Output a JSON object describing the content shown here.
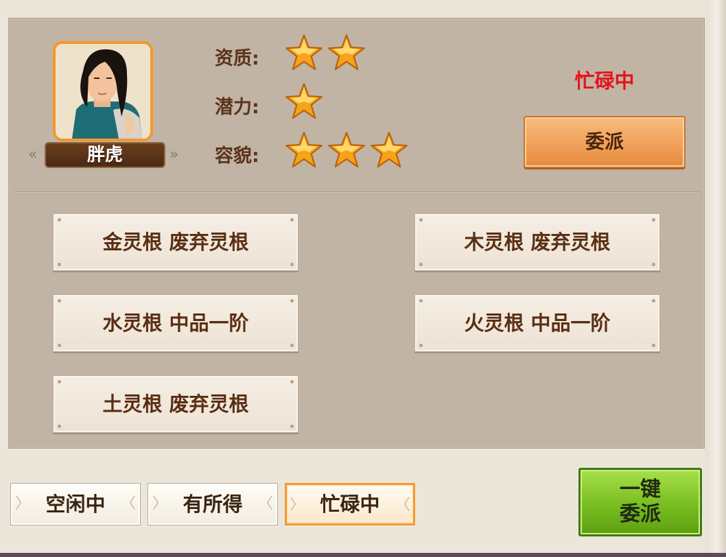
{
  "character": {
    "name": "胖虎",
    "status": "忙碌中",
    "assign_label": "委派",
    "stats": [
      {
        "label": "资质:",
        "stars": 2
      },
      {
        "label": "潜力:",
        "stars": 1
      },
      {
        "label": "容貌:",
        "stars": 3
      }
    ],
    "spirit_roots": [
      {
        "text": "金灵根 废弃灵根"
      },
      {
        "text": "木灵根 废弃灵根"
      },
      {
        "text": "水灵根 中品一阶"
      },
      {
        "text": "火灵根 中品一阶"
      },
      {
        "text": "土灵根 废弃灵根"
      }
    ]
  },
  "tabs": [
    {
      "label": "空闲中",
      "active": false
    },
    {
      "label": "有所得",
      "active": false
    },
    {
      "label": "忙碌中",
      "active": true
    }
  ],
  "auto_assign": {
    "line1": "一键",
    "line2": "委派"
  },
  "colors": {
    "status_red": "#e4141a",
    "accent_orange": "#f29a2b",
    "green_button": "#7cc123",
    "label_brown": "#5a341c"
  }
}
